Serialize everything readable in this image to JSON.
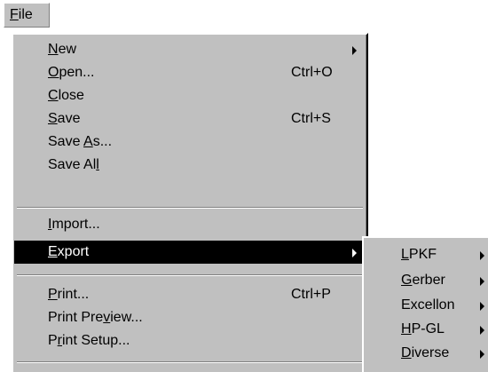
{
  "menubar": {
    "file": {
      "pre": "",
      "mn": "F",
      "post": "ile"
    }
  },
  "file_menu": {
    "items": [
      {
        "pre": "",
        "mn": "N",
        "post": "ew",
        "shortcut": "",
        "submenu": true
      },
      {
        "pre": "",
        "mn": "O",
        "post": "pen...",
        "shortcut": "Ctrl+O",
        "submenu": false
      },
      {
        "pre": "",
        "mn": "C",
        "post": "lose",
        "shortcut": "",
        "submenu": false
      },
      {
        "pre": "",
        "mn": "S",
        "post": "ave",
        "shortcut": "Ctrl+S",
        "submenu": false
      },
      {
        "pre": "Save ",
        "mn": "A",
        "post": "s...",
        "shortcut": "",
        "submenu": false
      },
      {
        "pre": "Save Al",
        "mn": "l",
        "post": "",
        "shortcut": "",
        "submenu": false
      },
      {
        "pre": "",
        "mn": "I",
        "post": "mport...",
        "shortcut": "",
        "submenu": false
      },
      {
        "pre": "",
        "mn": "E",
        "post": "xport",
        "shortcut": "",
        "submenu": true,
        "highlighted": true
      },
      {
        "pre": "",
        "mn": "P",
        "post": "rint...",
        "shortcut": "Ctrl+P",
        "submenu": false
      },
      {
        "pre": "Print Pre",
        "mn": "v",
        "post": "iew...",
        "shortcut": "",
        "submenu": false
      },
      {
        "pre": "P",
        "mn": "r",
        "post": "int Setup...",
        "shortcut": "",
        "submenu": false
      }
    ]
  },
  "export_submenu": {
    "items": [
      {
        "pre": "",
        "mn": "L",
        "post": "PKF",
        "submenu": true
      },
      {
        "pre": "",
        "mn": "G",
        "post": "erber",
        "submenu": true
      },
      {
        "pre": "Excellon",
        "mn": "",
        "post": "",
        "submenu": true
      },
      {
        "pre": "",
        "mn": "H",
        "post": "P-GL",
        "submenu": true
      },
      {
        "pre": "",
        "mn": "D",
        "post": "iverse",
        "submenu": true
      }
    ]
  },
  "colors": {
    "menu_face": "#c0c0c0",
    "highlight_bg": "#000000",
    "highlight_fg": "#ffffff"
  },
  "icons": {
    "submenu_arrow": "triangle-right-icon"
  }
}
